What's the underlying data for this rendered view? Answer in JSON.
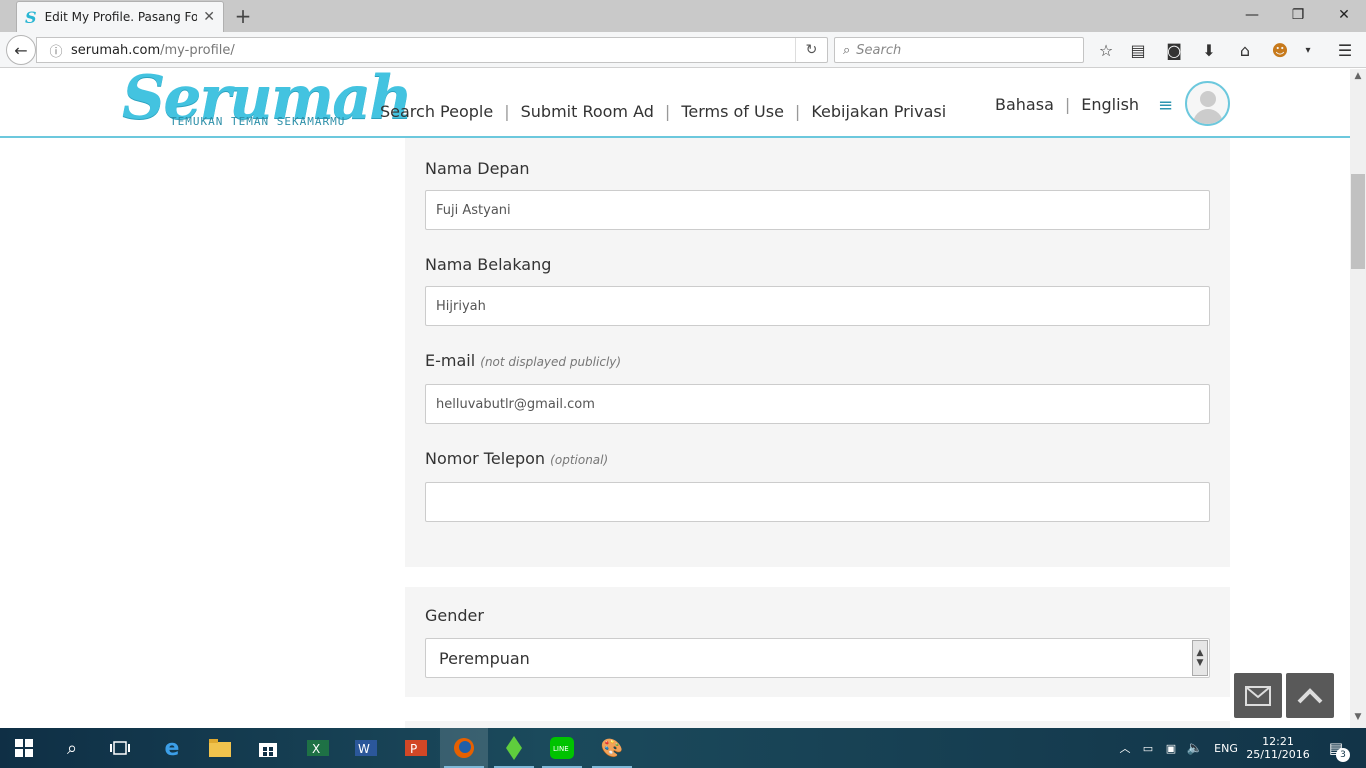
{
  "browser": {
    "tab_title": "Edit My Profile. Pasang Fo...",
    "tab_favicon": "S",
    "url_host": "serumah.com",
    "url_path": "/my-profile/",
    "search_placeholder": "Search"
  },
  "site": {
    "brand": "Serumah",
    "tagline": "TEMUKAN TEMAN SEKAMARMU",
    "nav": [
      "Search People",
      "Submit Room Ad",
      "Terms of Use",
      "Kebijakan Privasi"
    ],
    "lang_label": "Bahasa",
    "lang_value": "English"
  },
  "form": {
    "first_name": {
      "label": "Nama Depan",
      "value": "Fuji Astyani"
    },
    "last_name": {
      "label": "Nama Belakang",
      "value": "Hijriyah"
    },
    "email": {
      "label": "E-mail",
      "hint": "(not displayed publicly)",
      "value": "helluvabutlr@gmail.com"
    },
    "phone": {
      "label": "Nomor Telepon",
      "hint": "(optional)",
      "value": ""
    },
    "gender": {
      "label": "Gender",
      "value": "Perempuan"
    }
  },
  "taskbar": {
    "lang": "ENG",
    "time": "12:21",
    "date": "25/11/2016",
    "notifications": "3"
  },
  "colors": {
    "accent": "#43c3e0",
    "panel": "#f5f5f5",
    "taskbar": "#12364a"
  }
}
